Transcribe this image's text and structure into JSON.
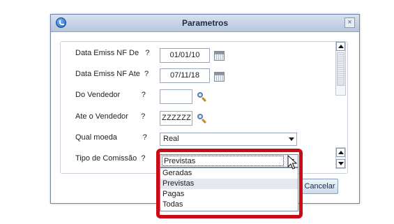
{
  "dialog": {
    "title": "Parametros",
    "close_glyph": "×"
  },
  "fields": [
    {
      "label": "Data Emiss NF De   ?",
      "value": "01/01/10",
      "icon": "calendar-icon"
    },
    {
      "label": "Data Emiss NF Ate  ?",
      "value": "07/11/18",
      "icon": "calendar-icon"
    },
    {
      "label": "Do Vendedor          ?",
      "value": "",
      "icon": "search-icon"
    },
    {
      "label": "Ate o Vendedor      ?",
      "value": "ZZZZZZ",
      "icon": "search-icon"
    },
    {
      "label": "Qual moeda            ?",
      "value": "Real",
      "icon": "chevron-down-icon"
    },
    {
      "label": "Tipo de Comissão  ?",
      "value": "Previstas",
      "icon": "chevron-down-icon"
    }
  ],
  "dropdown": {
    "selected": "Previstas",
    "options": [
      "Geradas",
      "Previstas",
      "Pagas",
      "Todas"
    ],
    "hovered_index": 1
  },
  "buttons": {
    "cancel_label": "Cancelar"
  },
  "colors": {
    "highlight": "#cc0a16",
    "titlebar": "#b7c6dc"
  }
}
